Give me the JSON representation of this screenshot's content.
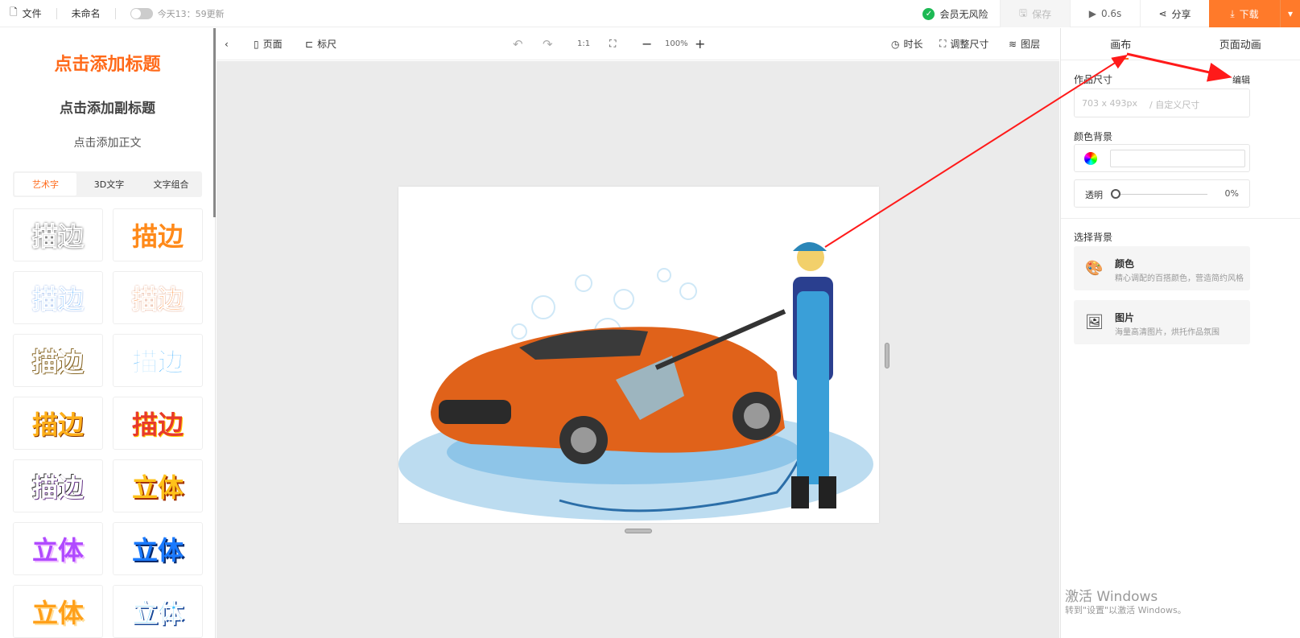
{
  "topbar": {
    "file": "文件",
    "doc_name": "未命名",
    "autosave": "今天13：59更新",
    "member": "会员无风险",
    "save": "保存",
    "duration": "0.6s",
    "share": "分享",
    "download": "下载"
  },
  "left": {
    "title": "点击添加标题",
    "subtitle": "点击添加副标题",
    "body": "点击添加正文",
    "tabs": [
      "艺术字",
      "3D文字",
      "文字组合"
    ],
    "tiles": [
      "描边",
      "描边",
      "描边",
      "描边",
      "描边",
      "描边",
      "描边",
      "描边",
      "描边",
      "立体",
      "立体",
      "立体",
      "立体",
      "立体"
    ]
  },
  "toolbar": {
    "page": "页面",
    "ruler": "标尺",
    "ratio": "1:1",
    "zoom": "100%",
    "duration": "时长",
    "resize": "调整尺寸",
    "layers": "图层"
  },
  "right": {
    "tabs": [
      "画布",
      "页面动画"
    ],
    "size_label": "作品尺寸",
    "edit": "编辑",
    "size_value": "703 x 493px",
    "custom_size": "/ 自定义尺寸",
    "color_bg": "颜色背景",
    "opacity_label": "透明",
    "opacity_value": "0%",
    "choose_bg": "选择背景",
    "cards": [
      {
        "title": "颜色",
        "desc": "精心调配的百搭颜色，营造简约风格"
      },
      {
        "title": "图片",
        "desc": "海量高清图片，烘托作品氛围"
      }
    ]
  },
  "watermark": {
    "line1": "激活 Windows",
    "line2": "转到\"设置\"以激活 Windows。"
  },
  "colors": {
    "accent": "#ff6a1a",
    "annotation": "#ff1a1a"
  }
}
